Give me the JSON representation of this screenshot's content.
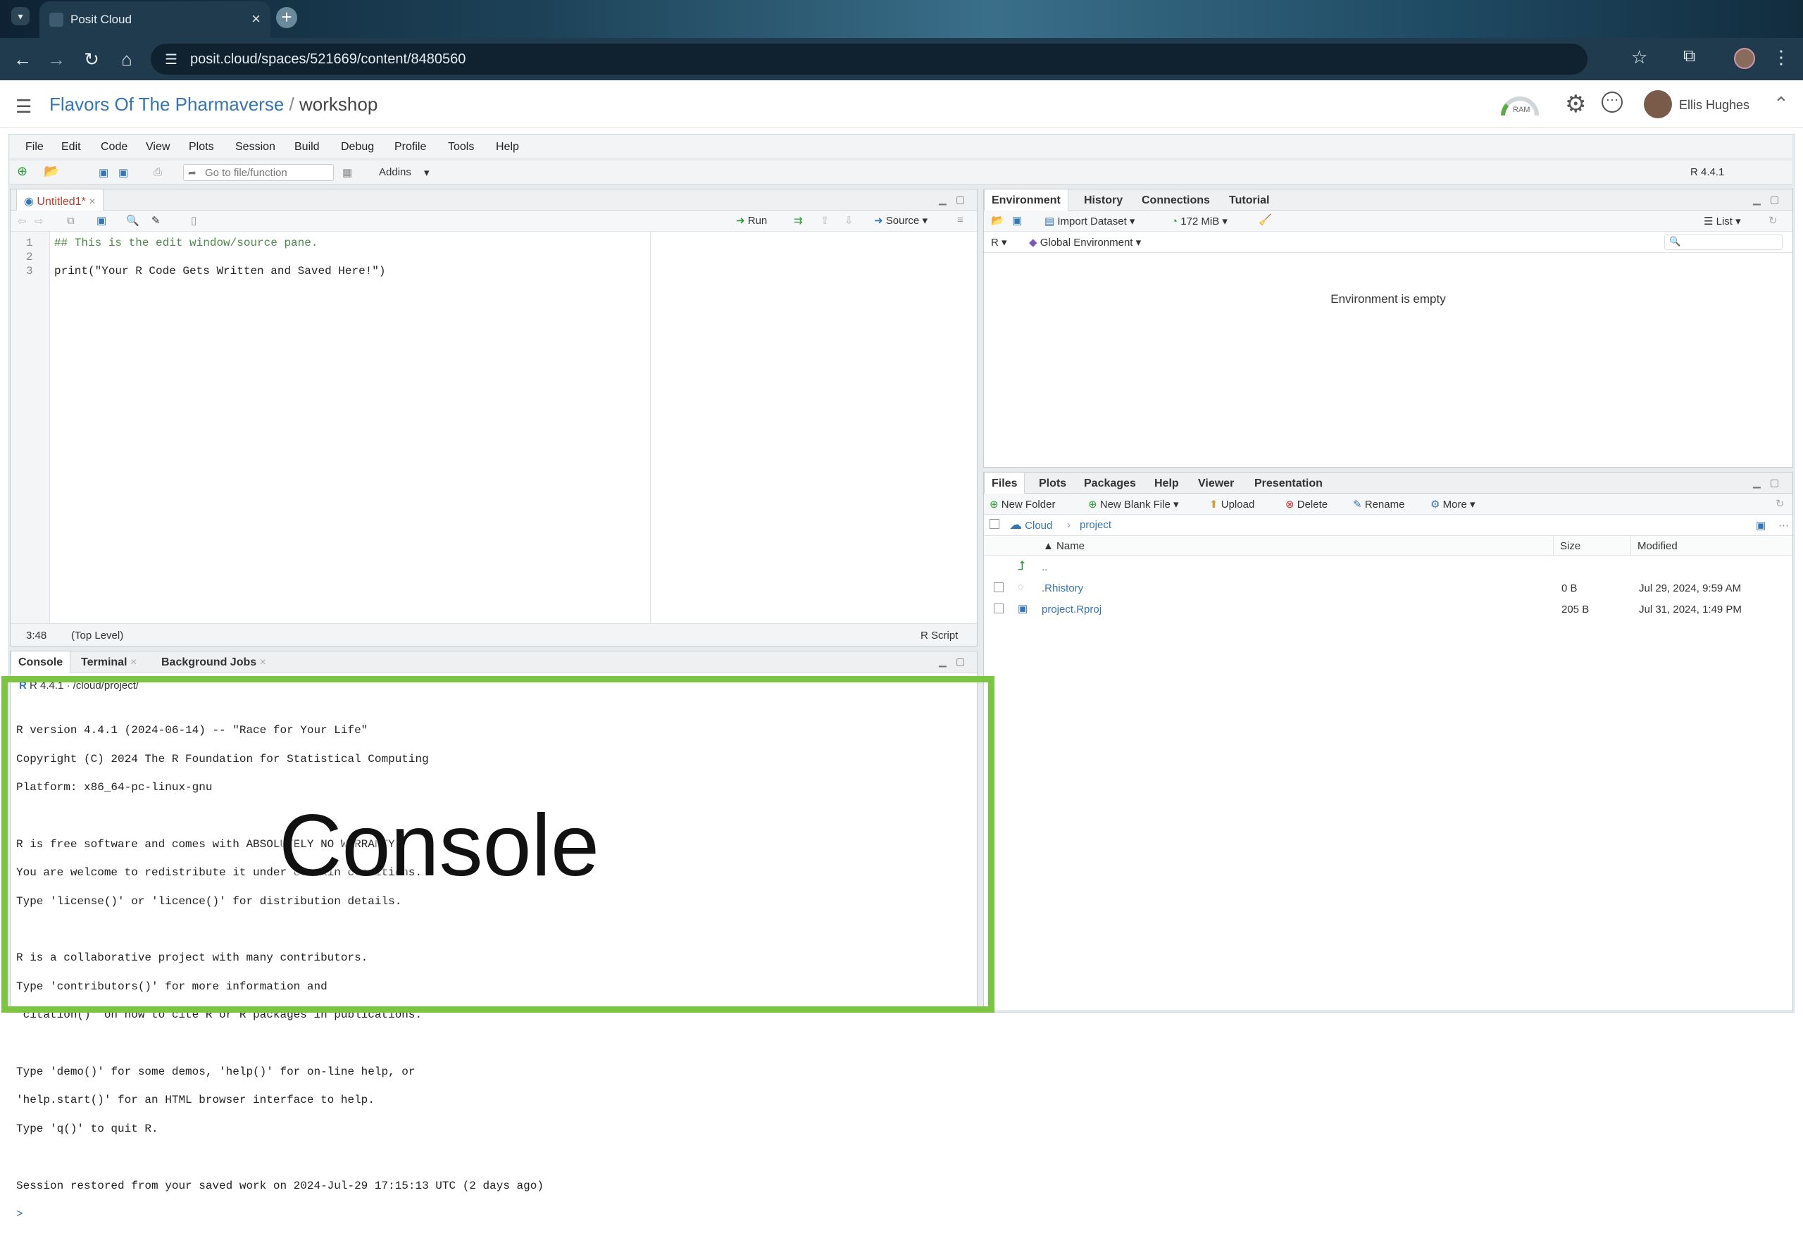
{
  "browser": {
    "tab_title": "Posit Cloud",
    "tab_close": "×",
    "new_tab": "+",
    "url": "posit.cloud/spaces/521669/content/8480560"
  },
  "header": {
    "project": "Flavors Of The Pharmaverse",
    "separator": "/",
    "workspace": "workshop",
    "ram_label": "RAM",
    "user": "Ellis Hughes"
  },
  "menu": [
    "File",
    "Edit",
    "Code",
    "View",
    "Plots",
    "Session",
    "Build",
    "Debug",
    "Profile",
    "Tools",
    "Help"
  ],
  "toolbar": {
    "goto_placeholder": "Go to file/function",
    "addins": "Addins",
    "r_version": "R 4.4.1"
  },
  "source": {
    "tab": "Untitled1*",
    "run": "Run",
    "source_btn": "Source",
    "lines": [
      "## This is the edit window/source pane.",
      "",
      "print(\"Your R Code Gets Written and Saved Here!\")"
    ],
    "line_numbers": [
      "1",
      "2",
      "3"
    ],
    "status_pos": "3:48",
    "status_scope": "(Top Level)",
    "status_type": "R Script"
  },
  "console": {
    "tabs": [
      "Console",
      "Terminal",
      "Background Jobs"
    ],
    "path": "R 4.4.1 · /cloud/project/",
    "lines": [
      "R version 4.4.1 (2024-06-14) -- \"Race for Your Life\"",
      "Copyright (C) 2024 The R Foundation for Statistical Computing",
      "Platform: x86_64-pc-linux-gnu",
      "",
      "R is free software and comes with ABSOLUTELY NO WARRANTY.",
      "You are welcome to redistribute it under certain conditions.",
      "Type 'license()' or 'licence()' for distribution details.",
      "",
      "R is a collaborative project with many contributors.",
      "Type 'contributors()' for more information and",
      "'citation()' on how to cite R or R packages in publications.",
      "",
      "Type 'demo()' for some demos, 'help()' for on-line help, or",
      "'help.start()' for an HTML browser interface to help.",
      "Type 'q()' to quit R.",
      "",
      "Session restored from your saved work on 2024-Jul-29 17:15:13 UTC (2 days ago)"
    ],
    "prompt": ">",
    "overlay_label": "Console"
  },
  "environment": {
    "tabs": [
      "Environment",
      "History",
      "Connections",
      "Tutorial"
    ],
    "import": "Import Dataset",
    "memory": "172 MiB",
    "view": "List",
    "lang": "R",
    "scope": "Global Environment",
    "empty_msg": "Environment is empty"
  },
  "files": {
    "tabs": [
      "Files",
      "Plots",
      "Packages",
      "Help",
      "Viewer",
      "Presentation"
    ],
    "actions": {
      "new_folder": "New Folder",
      "new_blank": "New Blank File",
      "upload": "Upload",
      "delete": "Delete",
      "rename": "Rename",
      "more": "More"
    },
    "path_root": "Cloud",
    "path_sub": "project",
    "cols": {
      "name": "Name",
      "size": "Size",
      "modified": "Modified"
    },
    "up": "..",
    "rows": [
      {
        "name": ".Rhistory",
        "size": "0 B",
        "modified": "Jul 29, 2024, 9:59 AM"
      },
      {
        "name": "project.Rproj",
        "size": "205 B",
        "modified": "Jul 31, 2024, 1:49 PM"
      }
    ]
  }
}
